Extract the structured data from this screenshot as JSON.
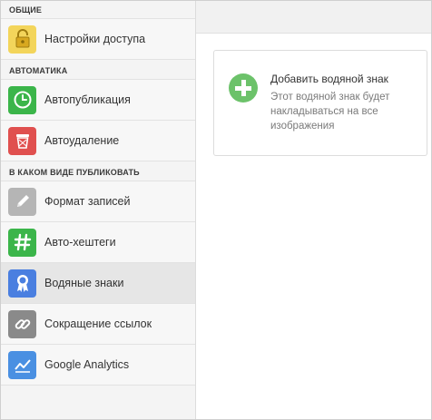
{
  "sidebar": {
    "sections": [
      {
        "title": "ОБЩИЕ",
        "items": [
          {
            "label": "Настройки доступа",
            "icon": "lock-icon",
            "color": "#f3d55b"
          }
        ]
      },
      {
        "title": "АВТОМАТИКА",
        "items": [
          {
            "label": "Автопубликация",
            "icon": "clock-icon",
            "color": "#3bb54a"
          },
          {
            "label": "Автоудаление",
            "icon": "trash-icon",
            "color": "#e0504f"
          }
        ]
      },
      {
        "title": "В КАКОМ ВИДЕ ПУБЛИКОВАТЬ",
        "items": [
          {
            "label": "Формат записей",
            "icon": "pencil-icon",
            "color": "#b5b5b5"
          },
          {
            "label": "Авто-хештеги",
            "icon": "hashtag-icon",
            "color": "#3bb54a"
          },
          {
            "label": "Водяные знаки",
            "icon": "ribbon-icon",
            "color": "#4a7fe0",
            "active": true
          },
          {
            "label": "Сокращение ссылок",
            "icon": "link-icon",
            "color": "#8a8a8a"
          },
          {
            "label": "Google Analytics",
            "icon": "chart-icon",
            "color": "#4a90e2"
          }
        ]
      }
    ]
  },
  "main": {
    "watermark_card": {
      "title": "Добавить водяной знак",
      "description": "Этот водяной знак будет накладываться на все изображения",
      "icon": "plus-circle-icon",
      "color": "#6cc26a"
    }
  }
}
